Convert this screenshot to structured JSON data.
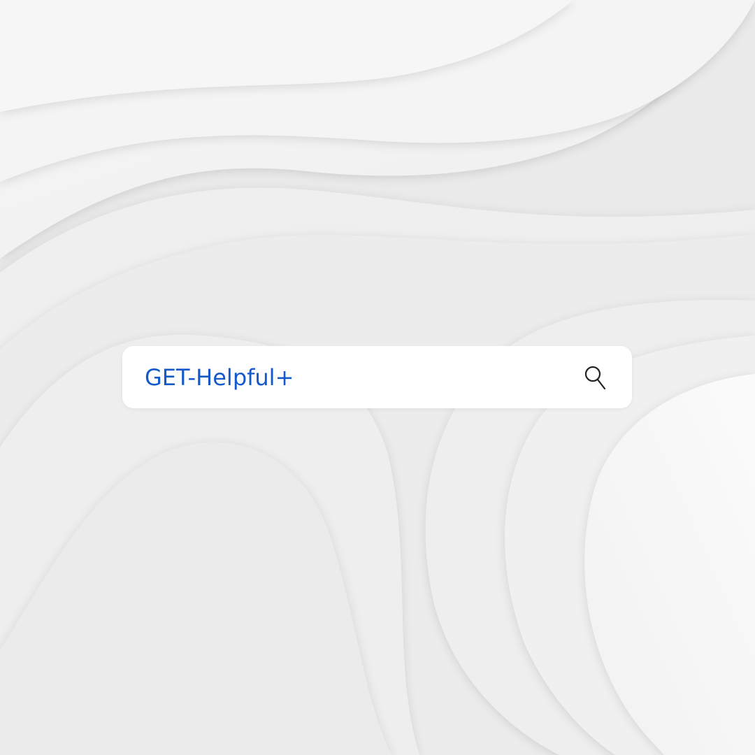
{
  "search": {
    "value": "GET-Helpful+",
    "icon": "search-icon"
  },
  "colors": {
    "background": "#ececed",
    "search_bar": "#ffffff",
    "text": "#1459c9",
    "icon": "#222222"
  }
}
